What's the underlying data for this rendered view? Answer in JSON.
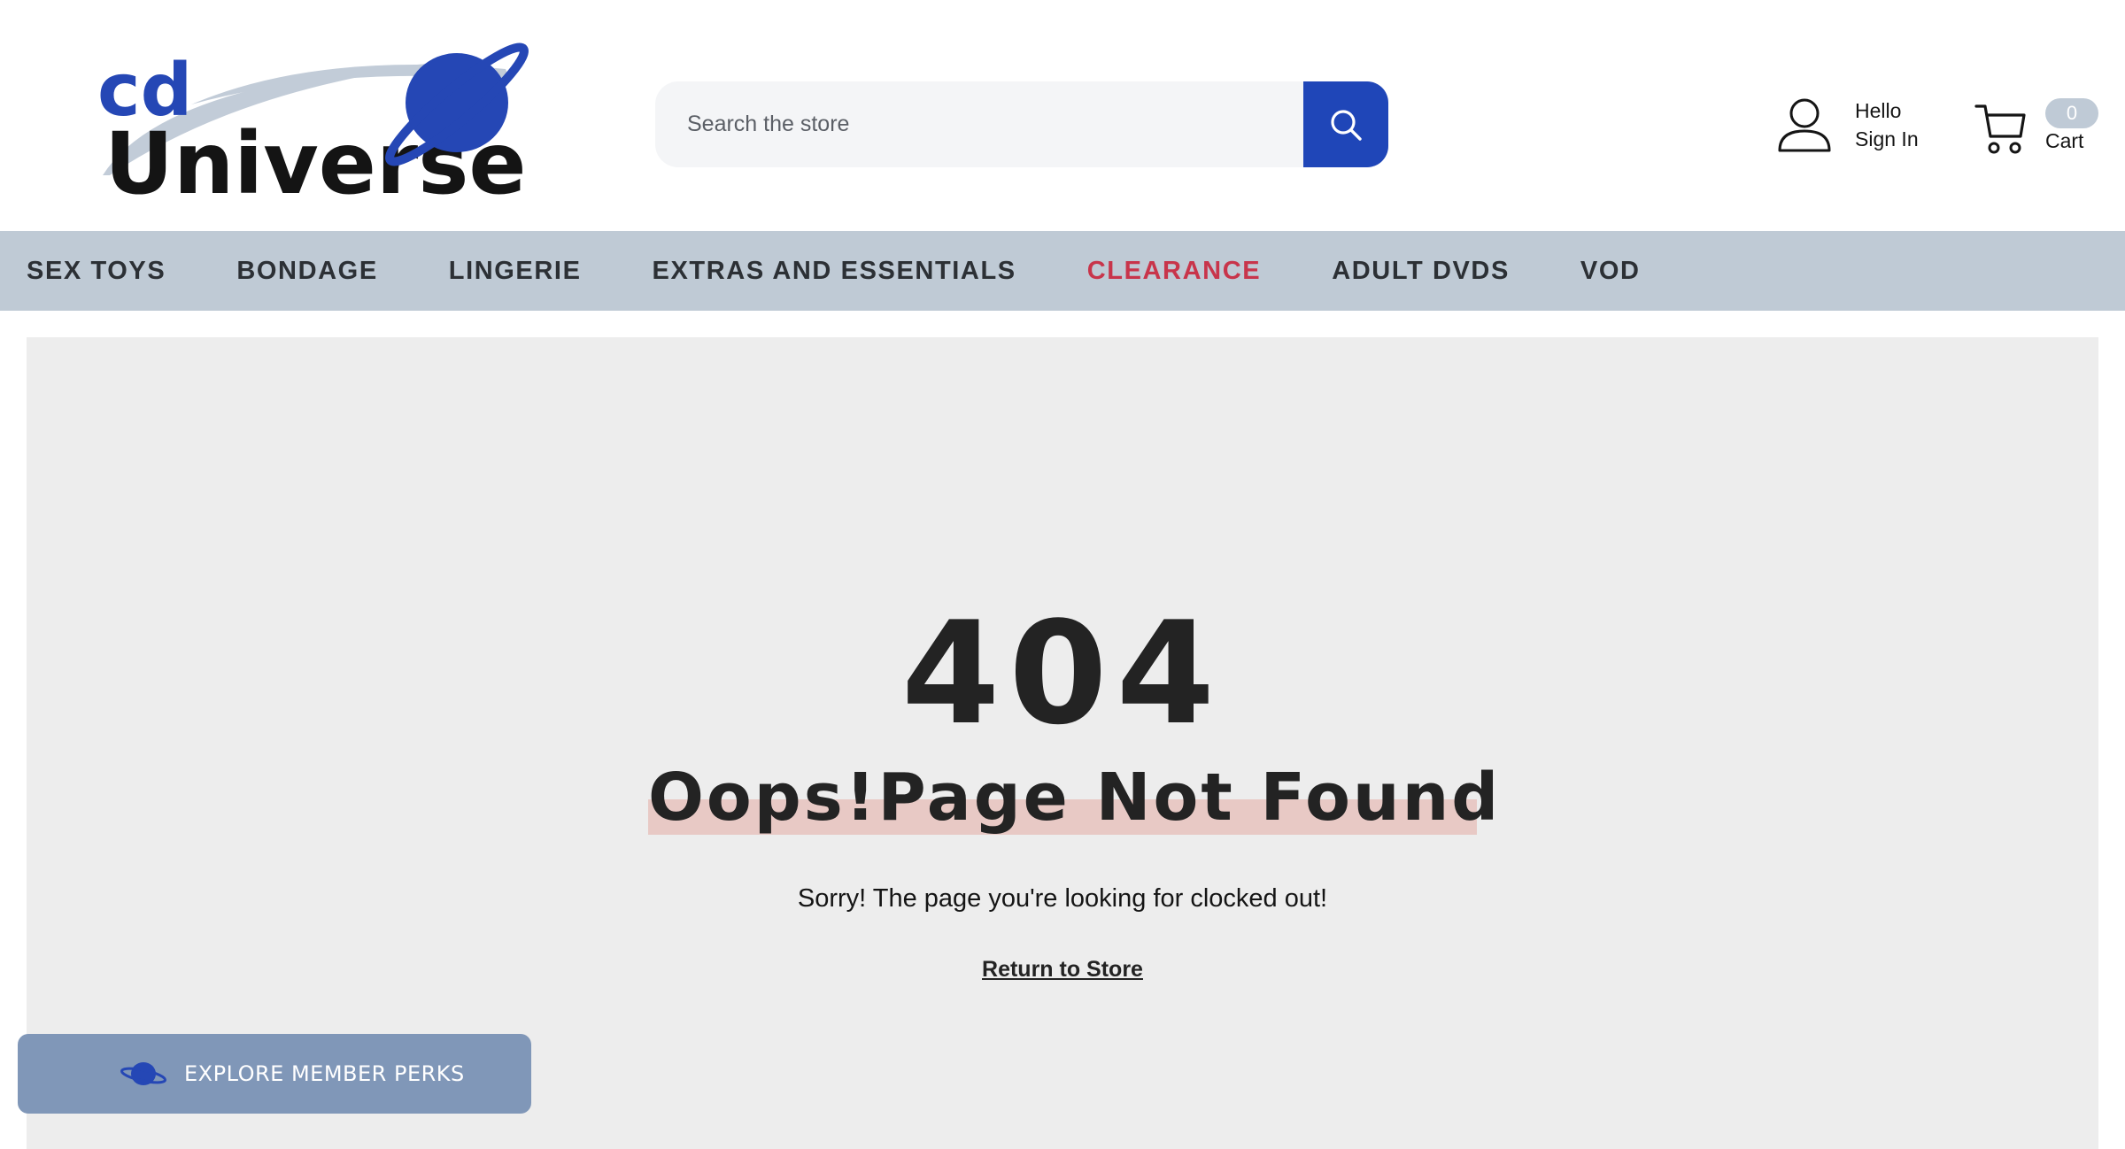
{
  "header": {
    "logo": {
      "text_top": "cd",
      "text_bottom": "Universe",
      "brand_color": "#2547b5"
    },
    "search": {
      "placeholder": "Search the store",
      "button_icon": "search-icon",
      "button_color": "#1f46b8"
    },
    "account": {
      "greeting": "Hello",
      "action": "Sign In",
      "icon": "user-icon"
    },
    "cart": {
      "count": "0",
      "label": "Cart",
      "icon": "cart-icon"
    }
  },
  "nav": {
    "items": [
      {
        "label": "SEX TOYS"
      },
      {
        "label": "BONDAGE"
      },
      {
        "label": "LINGERIE"
      },
      {
        "label": "EXTRAS AND ESSENTIALS"
      },
      {
        "label": "CLEARANCE",
        "color": "#c8354b"
      },
      {
        "label": "ADULT DVDS"
      },
      {
        "label": "VOD"
      }
    ],
    "background": "#bfcad5"
  },
  "error": {
    "code": "404",
    "title": "Oops!Page Not Found",
    "message": "Sorry! The page you're looking for clocked out!",
    "link": "Return to Store"
  },
  "perks": {
    "label": "EXPLORE MEMBER PERKS",
    "icon": "planet-icon",
    "background": "#8097b8"
  }
}
